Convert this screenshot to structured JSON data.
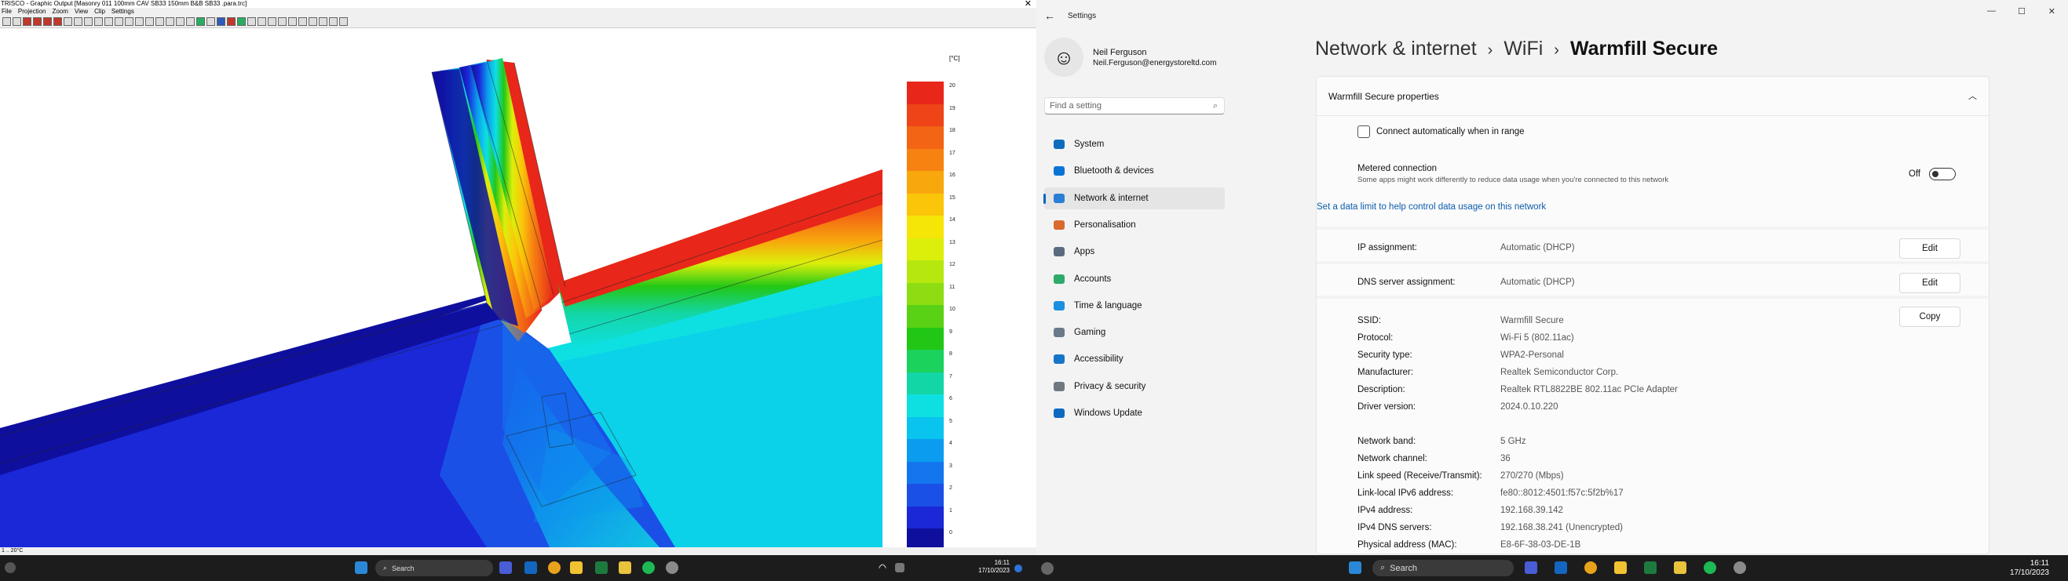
{
  "left_app": {
    "title": "TRISCO - Graphic Output [Masonry 011 100mm CAV SB33 150mm B&B SB33 .para.trc]",
    "close": "✕",
    "menu": [
      "File",
      "Projection",
      "Zoom",
      "View",
      "Clip",
      "Settings"
    ],
    "legend": {
      "unit": "[°C]",
      "labels": [
        "20",
        "19",
        "18",
        "17",
        "16",
        "15",
        "14",
        "13",
        "12",
        "11",
        "10",
        "9",
        "8",
        "7",
        "6",
        "5",
        "4",
        "3",
        "2",
        "1",
        "0"
      ],
      "colors": [
        "#e8261a",
        "#ef4417",
        "#f36414",
        "#f68311",
        "#f8a80c",
        "#fbc509",
        "#f5e607",
        "#dcef0a",
        "#b6e80f",
        "#8ddd12",
        "#59d114",
        "#22c716",
        "#1ad25c",
        "#13d6a7",
        "#0ee0e2",
        "#09c4ef",
        "#0b9cef",
        "#1376ef",
        "#1b50e6",
        "#1a28d8",
        "#0f0f9e"
      ]
    },
    "status": "1 .. 20°C"
  },
  "left_taskbar": {
    "search": "Search",
    "time": "16:11",
    "date": "17/10/2023"
  },
  "settings": {
    "app_title": "Settings",
    "user": {
      "name": "Neil Ferguson",
      "email": "Neil.Ferguson@energystoreltd.com"
    },
    "search_placeholder": "Find a setting",
    "nav": [
      {
        "label": "System",
        "color": "#0f6cbd"
      },
      {
        "label": "Bluetooth & devices",
        "color": "#0a74d6"
      },
      {
        "label": "Network & internet",
        "color": "#2a7fd4"
      },
      {
        "label": "Personalisation",
        "color": "#d96a2e"
      },
      {
        "label": "Apps",
        "color": "#5a6b7d"
      },
      {
        "label": "Accounts",
        "color": "#2eaa6b"
      },
      {
        "label": "Time & language",
        "color": "#1b8fe0"
      },
      {
        "label": "Gaming",
        "color": "#6b7a89"
      },
      {
        "label": "Accessibility",
        "color": "#1674c9"
      },
      {
        "label": "Privacy & security",
        "color": "#6f7780"
      },
      {
        "label": "Windows Update",
        "color": "#0b6bbf"
      }
    ],
    "breadcrumb": {
      "part1": "Network & internet",
      "part2": "WiFi",
      "part3": "Warmfill Secure",
      "sep": "›"
    },
    "card": {
      "header": "Warmfill Secure properties",
      "connect_auto": "Connect automatically when in range",
      "metered_title": "Metered connection",
      "metered_desc": "Some apps might work differently to reduce data usage when you're connected to this network",
      "metered_state": "Off",
      "data_limit_link": "Set a data limit to help control data usage on this network",
      "ip_assignment_label": "IP assignment:",
      "ip_assignment_value": "Automatic (DHCP)",
      "dns_assignment_label": "DNS server assignment:",
      "dns_assignment_value": "Automatic (DHCP)",
      "edit": "Edit",
      "copy": "Copy",
      "details": [
        {
          "k": "SSID:",
          "v": "Warmfill Secure"
        },
        {
          "k": "Protocol:",
          "v": "Wi-Fi 5 (802.11ac)"
        },
        {
          "k": "Security type:",
          "v": "WPA2-Personal"
        },
        {
          "k": "Manufacturer:",
          "v": "Realtek Semiconductor Corp."
        },
        {
          "k": "Description:",
          "v": "Realtek RTL8822BE 802.11ac PCIe Adapter"
        },
        {
          "k": "Driver version:",
          "v": "2024.0.10.220"
        },
        {
          "k": "Network band:",
          "v": "5 GHz"
        },
        {
          "k": "Network channel:",
          "v": "36"
        },
        {
          "k": "Link speed (Receive/Transmit):",
          "v": "270/270 (Mbps)"
        },
        {
          "k": "Link-local IPv6 address:",
          "v": "fe80::8012:4501:f57c:5f2b%17"
        },
        {
          "k": "IPv4 address:",
          "v": "192.168.39.142"
        },
        {
          "k": "IPv4 DNS servers:",
          "v": "192.168.38.241 (Unencrypted)"
        },
        {
          "k": "Physical address (MAC):",
          "v": "E8-6F-38-03-DE-1B"
        }
      ]
    }
  },
  "right_taskbar": {
    "search": "Search",
    "time": "16:11",
    "date": "17/10/2023"
  }
}
